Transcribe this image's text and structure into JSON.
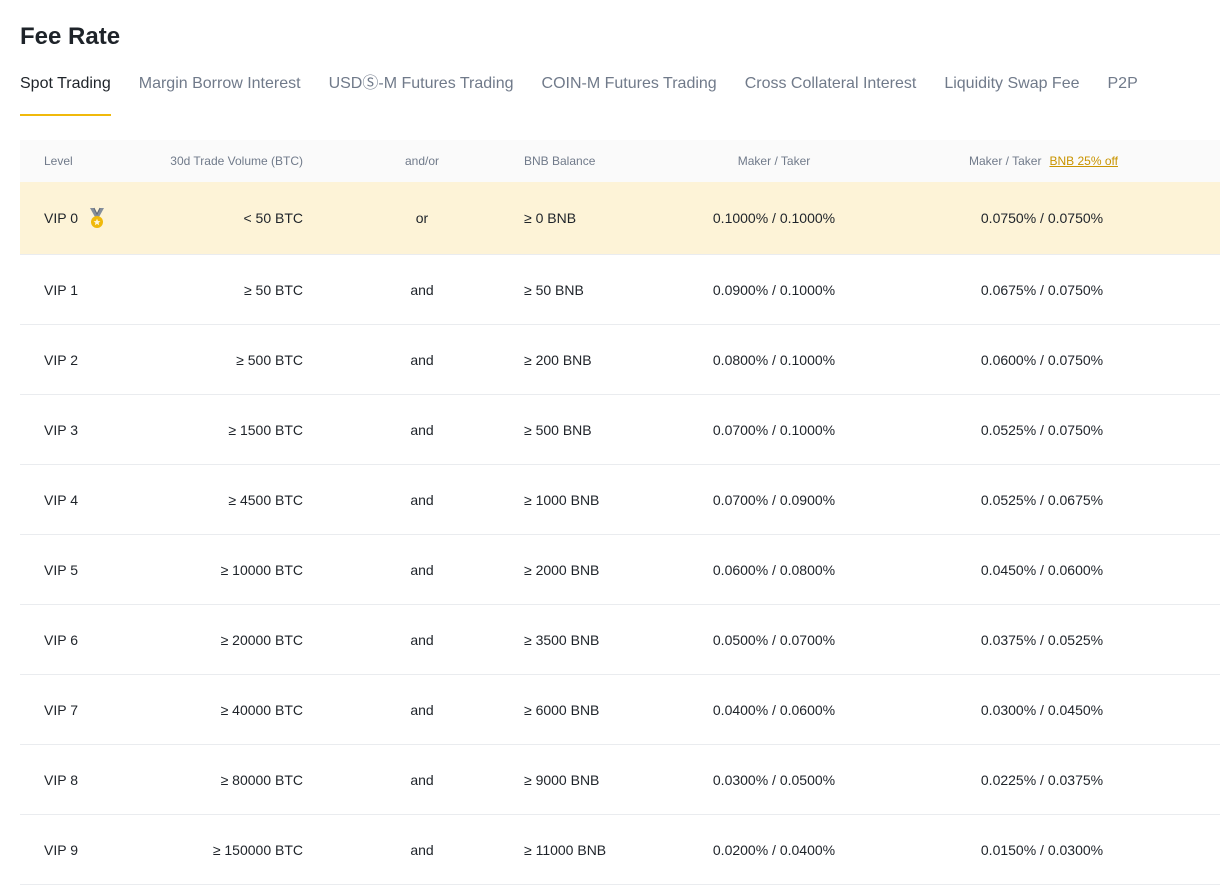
{
  "page": {
    "title": "Fee Rate"
  },
  "tabs": [
    {
      "label": "Spot Trading",
      "active": true
    },
    {
      "label": "Margin Borrow Interest"
    },
    {
      "label": "USDⓈ-M Futures Trading"
    },
    {
      "label": "COIN-M Futures Trading"
    },
    {
      "label": "Cross Collateral Interest"
    },
    {
      "label": "Liquidity Swap Fee"
    },
    {
      "label": "P2P"
    }
  ],
  "table": {
    "headers": {
      "level": "Level",
      "volume": "30d Trade Volume (BTC)",
      "andor": "and/or",
      "bnb_balance": "BNB Balance",
      "maker_taker": "Maker / Taker",
      "maker_taker_discount": "Maker / Taker",
      "discount_link": "BNB 25% off"
    },
    "current_level_icon": "medal-icon",
    "rows": [
      {
        "level": "VIP 0",
        "volume": "< 50 BTC",
        "andor": "or",
        "bnb": "≥ 0 BNB",
        "fee": "0.1000% / 0.1000%",
        "disc": "0.0750% / 0.0750%",
        "current": true
      },
      {
        "level": "VIP 1",
        "volume": "≥ 50 BTC",
        "andor": "and",
        "bnb": "≥ 50 BNB",
        "fee": "0.0900% / 0.1000%",
        "disc": "0.0675% / 0.0750%"
      },
      {
        "level": "VIP 2",
        "volume": "≥ 500 BTC",
        "andor": "and",
        "bnb": "≥ 200 BNB",
        "fee": "0.0800% / 0.1000%",
        "disc": "0.0600% / 0.0750%"
      },
      {
        "level": "VIP 3",
        "volume": "≥ 1500 BTC",
        "andor": "and",
        "bnb": "≥ 500 BNB",
        "fee": "0.0700% / 0.1000%",
        "disc": "0.0525% / 0.0750%"
      },
      {
        "level": "VIP 4",
        "volume": "≥ 4500 BTC",
        "andor": "and",
        "bnb": "≥ 1000 BNB",
        "fee": "0.0700% / 0.0900%",
        "disc": "0.0525% / 0.0675%"
      },
      {
        "level": "VIP 5",
        "volume": "≥ 10000 BTC",
        "andor": "and",
        "bnb": "≥ 2000 BNB",
        "fee": "0.0600% / 0.0800%",
        "disc": "0.0450% / 0.0600%"
      },
      {
        "level": "VIP 6",
        "volume": "≥ 20000 BTC",
        "andor": "and",
        "bnb": "≥ 3500 BNB",
        "fee": "0.0500% / 0.0700%",
        "disc": "0.0375% / 0.0525%"
      },
      {
        "level": "VIP 7",
        "volume": "≥ 40000 BTC",
        "andor": "and",
        "bnb": "≥ 6000 BNB",
        "fee": "0.0400% / 0.0600%",
        "disc": "0.0300% / 0.0450%"
      },
      {
        "level": "VIP 8",
        "volume": "≥ 80000 BTC",
        "andor": "and",
        "bnb": "≥ 9000 BNB",
        "fee": "0.0300% / 0.0500%",
        "disc": "0.0225% / 0.0375%"
      },
      {
        "level": "VIP 9",
        "volume": "≥ 150000 BTC",
        "andor": "and",
        "bnb": "≥ 11000 BNB",
        "fee": "0.0200% / 0.0400%",
        "disc": "0.0150% / 0.0300%"
      }
    ]
  },
  "colors": {
    "accent": "#f0b90b",
    "link": "#c99400",
    "highlight_row": "#fdf3d7",
    "muted_text": "#707a8a"
  }
}
